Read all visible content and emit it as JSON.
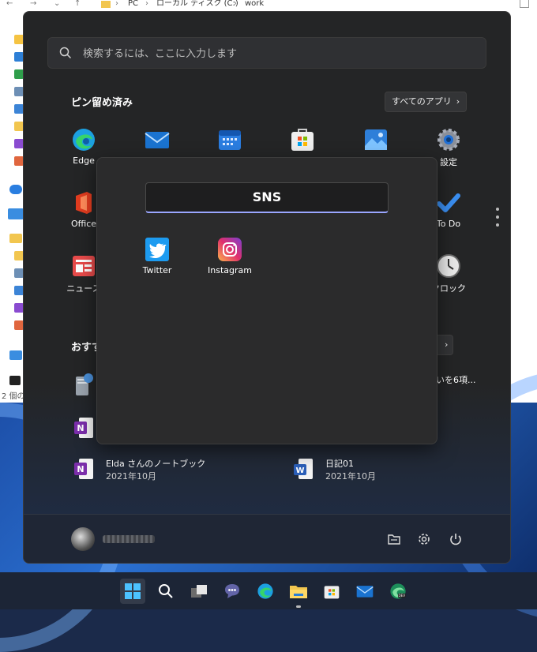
{
  "explorer": {
    "breadcrumb": [
      "PC",
      "ローカル ディスク (C:)",
      "work"
    ],
    "status_text": "2 個の"
  },
  "start_menu": {
    "search_placeholder": "検索するには、ここに入力します",
    "pinned_title": "ピン留め済み",
    "all_apps_label": "すべてのアプリ",
    "pinned_apps": [
      {
        "label": "Edge",
        "icon": "edge-icon"
      },
      {
        "label": "",
        "icon": "mail-icon"
      },
      {
        "label": "",
        "icon": "calendar-icon"
      },
      {
        "label": "",
        "icon": "store-icon"
      },
      {
        "label": "",
        "icon": "photos-icon"
      },
      {
        "label": "設定",
        "icon": "settings-icon"
      },
      {
        "label": "Office",
        "icon": "office-icon"
      },
      {
        "label": "To Do",
        "icon": "todo-icon"
      },
      {
        "label": "ニュース",
        "icon": "news-icon"
      },
      {
        "label": "クロック",
        "icon": "clock-icon"
      }
    ],
    "recommended_title": "おすす",
    "more_label": "",
    "recommended": [
      {
        "title": "",
        "date": "",
        "icon": "server-file-icon"
      },
      {
        "title": "いを6項...",
        "date": "",
        "icon": ""
      },
      {
        "title": "",
        "date": "",
        "icon": "onenote-icon"
      },
      {
        "title": "Elda さんのノートブック",
        "date": "2021年10月",
        "icon": "onenote-icon"
      },
      {
        "title": "日記01",
        "date": "2021年10月",
        "icon": "word-icon"
      }
    ],
    "user_name": "",
    "folder": {
      "name": "SNS",
      "apps": [
        {
          "label": "Twitter",
          "icon": "twitter-icon"
        },
        {
          "label": "Instagram",
          "icon": "instagram-icon"
        }
      ]
    }
  },
  "taskbar": {
    "items": [
      "windows-start-icon",
      "search-icon",
      "task-view-icon",
      "chat-icon",
      "edge-icon",
      "file-explorer-icon",
      "store-icon",
      "mail-icon",
      "edge-dev-icon"
    ]
  },
  "colors": {
    "accent": "#9aa6ff",
    "menu_bg": "#242526",
    "twitter": "#1d9bf0",
    "edge": "#1ca0e0"
  }
}
